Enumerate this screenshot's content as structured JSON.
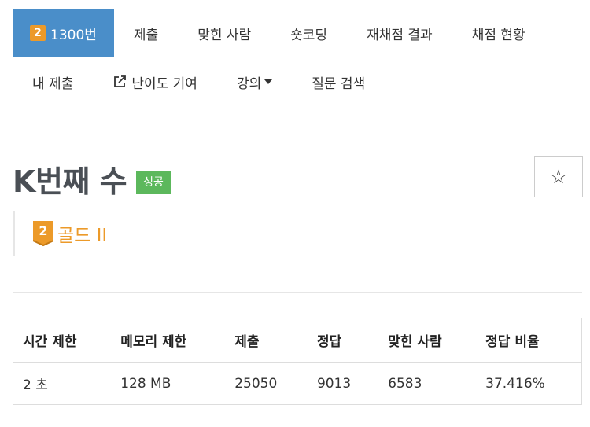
{
  "nav": {
    "problem_number": "1300번",
    "problem_tier_digit": "2",
    "row1": [
      "제출",
      "맞힌 사람",
      "숏코딩",
      "재채점 결과",
      "채점 현황"
    ],
    "my_submit": "내 제출",
    "difficulty": "난이도 기여",
    "lecture": "강의",
    "qna": "질문 검색"
  },
  "problem": {
    "title": "K번째 수",
    "status": "성공",
    "tier_digit": "2",
    "tier_name": "골드 II",
    "star": "☆"
  },
  "table": {
    "headers": [
      "시간 제한",
      "메모리 제한",
      "제출",
      "정답",
      "맞힌 사람",
      "정답 비율"
    ],
    "row": [
      "2 초",
      "128 MB",
      "25050",
      "9013",
      "6583",
      "37.416%"
    ]
  },
  "colors": {
    "accent": "#4a8ec9",
    "gold": "#ec9a29",
    "success": "#5cb85c"
  },
  "icons": [
    "external-link-icon",
    "star-icon",
    "tier-shield-icon",
    "caret-down-icon"
  ]
}
